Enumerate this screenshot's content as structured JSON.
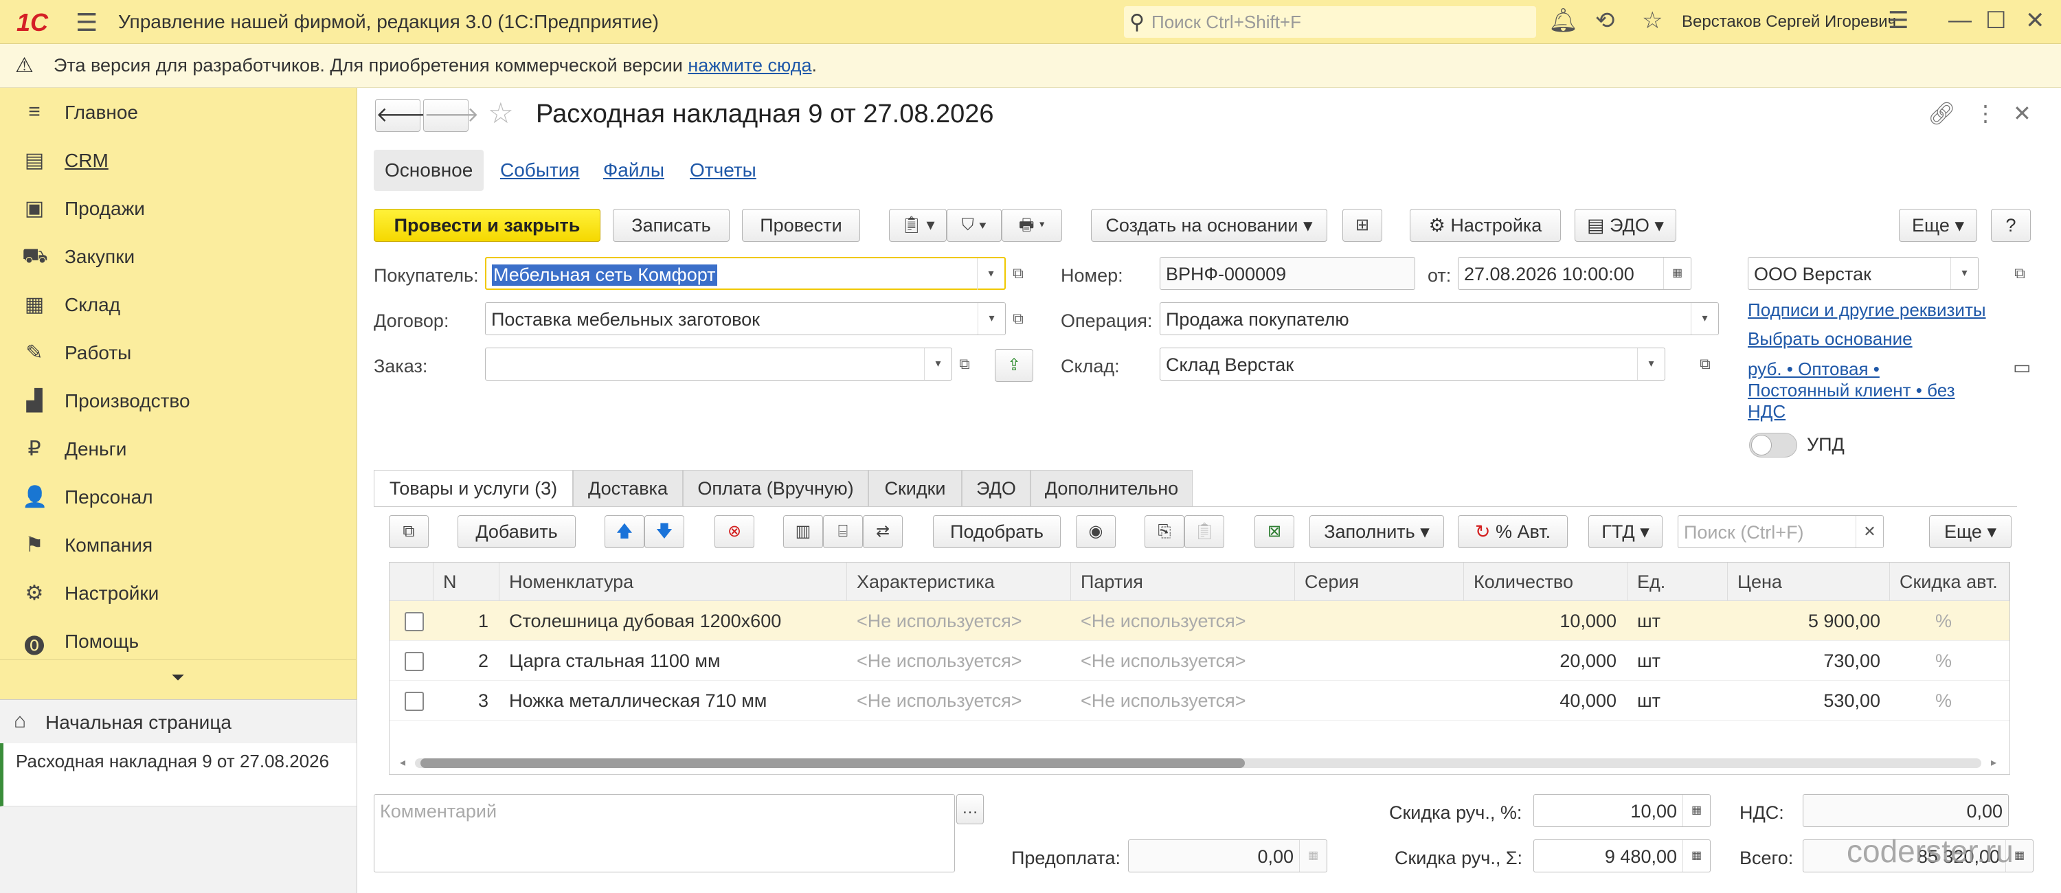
{
  "titlebar": {
    "logo": "1С",
    "app_title": "Управление нашей фирмой, редакция 3.0  (1С:Предприятие)",
    "search_placeholder": "Поиск Ctrl+Shift+F",
    "user": "Верстаков Сергей Игоревич",
    "icons": [
      "bell-icon",
      "history-icon",
      "star-icon",
      "settings-lines-icon",
      "minimize-icon",
      "maximize-icon",
      "close-icon"
    ]
  },
  "banner": {
    "text": "Эта версия для разработчиков. Для приобретения коммерческой версии ",
    "link": "нажмите сюда",
    "tail": "."
  },
  "sidebar": {
    "items": [
      {
        "label": "Главное",
        "icon": "≡"
      },
      {
        "label": "CRM",
        "icon": "▤"
      },
      {
        "label": "Продажи",
        "icon": "▣"
      },
      {
        "label": "Закупки",
        "icon": "⛟"
      },
      {
        "label": "Склад",
        "icon": "▦"
      },
      {
        "label": "Работы",
        "icon": "✎"
      },
      {
        "label": "Производство",
        "icon": "▟"
      },
      {
        "label": "Деньги",
        "icon": "₽"
      },
      {
        "label": "Персонал",
        "icon": "👤"
      },
      {
        "label": "Компания",
        "icon": "⚑"
      },
      {
        "label": "Настройки",
        "icon": "⚙"
      },
      {
        "label": "Помощь",
        "icon": "⓿"
      }
    ],
    "more_arrow": "⏷",
    "home": "Начальная страница",
    "open_doc": "Расходная накладная 9 от 27.08.2026"
  },
  "doc": {
    "title": "Расходная накладная 9 от 27.08.2026",
    "tabs": [
      "Основное",
      "События",
      "Файлы",
      "Отчеты"
    ],
    "toolbar": {
      "post_close": "Провести и закрыть",
      "save": "Записать",
      "post": "Провести",
      "create_based": "Создать на основании",
      "settings": "Настройка",
      "edo": "ЭДО",
      "more": "Еще",
      "help": "?"
    },
    "fields": {
      "buyer_label": "Покупатель:",
      "buyer": "Мебельная сеть Комфорт",
      "contract_label": "Договор:",
      "contract": "Поставка мебельных заготовок",
      "order_label": "Заказ:",
      "order": "",
      "number_label": "Номер:",
      "number": "ВРНФ-000009",
      "date_label": "от:",
      "date": "27.08.2026 10:00:00",
      "operation_label": "Операция:",
      "operation": "Продажа покупателю",
      "warehouse_label": "Склад:",
      "warehouse": "Склад Верстак",
      "company": "ООО Верстак"
    },
    "links": {
      "signatures": "Подписи и другие реквизиты",
      "choose_basis": "Выбрать основание",
      "price_line1": "руб. • Оптовая •",
      "price_line2": "Постоянный клиент • без",
      "price_line3": "НДС"
    },
    "upd_label": "УПД",
    "upd_on": false
  },
  "inner_tabs": [
    "Товары и услуги (3)",
    "Доставка",
    "Оплата (Вручную)",
    "Скидки",
    "ЭДО",
    "Дополнительно"
  ],
  "grid_toolbar": {
    "add": "Добавить",
    "pick": "Подобрать",
    "fill": "Заполнить",
    "auto_pct": "% Авт.",
    "gtd": "ГТД",
    "search_placeholder": "Поиск (Ctrl+F)",
    "more": "Еще"
  },
  "grid": {
    "columns": [
      "N",
      "Номенклатура",
      "Характеристика",
      "Партия",
      "Серия",
      "Количество",
      "Ед.",
      "Цена",
      "Скидка авт."
    ],
    "rows": [
      {
        "n": "1",
        "item": "Столешница дубовая 1200х600",
        "char": "<Не используется>",
        "batch": "<Не используется>",
        "series": "",
        "qty": "10,000",
        "unit": "шт",
        "price": "5 900,00",
        "disc": "%"
      },
      {
        "n": "2",
        "item": "Царга стальная 1100 мм",
        "char": "<Не используется>",
        "batch": "<Не используется>",
        "series": "",
        "qty": "20,000",
        "unit": "шт",
        "price": "730,00",
        "disc": "%"
      },
      {
        "n": "3",
        "item": "Ножка металлическая 710 мм",
        "char": "<Не используется>",
        "batch": "<Не используется>",
        "series": "",
        "qty": "40,000",
        "unit": "шт",
        "price": "530,00",
        "disc": "%"
      }
    ]
  },
  "footer": {
    "comment_placeholder": "Комментарий",
    "manual_disc_pct_label": "Скидка руч., %:",
    "manual_disc_pct": "10,00",
    "vat_label": "НДС:",
    "vat": "0,00",
    "prepay_label": "Предоплата:",
    "prepay": "0,00",
    "manual_disc_sum_label": "Скидка руч., Σ:",
    "manual_disc_sum": "9 480,00",
    "total_label": "Всего:",
    "total": "85 320,00"
  },
  "watermark": "coderster.ru"
}
